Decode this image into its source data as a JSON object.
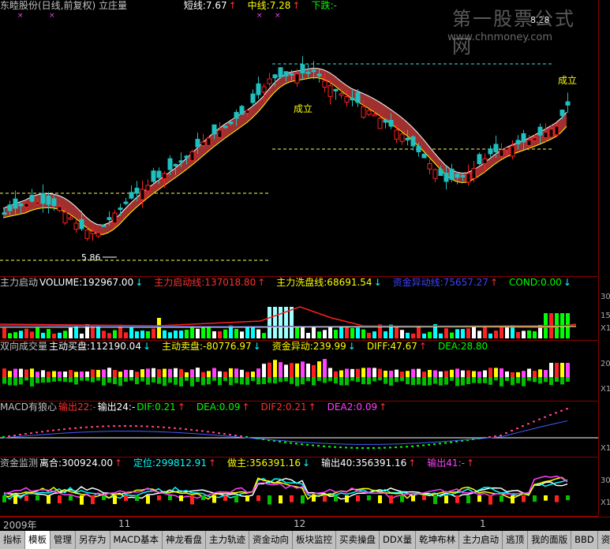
{
  "main": {
    "title": "东睦股份(日线,前复权) 立庄量",
    "legend": [
      {
        "text": "短线:7.67",
        "color": "#ffffff"
      },
      {
        "text": "↑",
        "color": "#ff3030"
      },
      {
        "text": "中线:7.28",
        "color": "#ffff00"
      },
      {
        "text": "↑",
        "color": "#ff3030"
      },
      {
        "text": "下跌:-",
        "color": "#00ff00"
      }
    ],
    "high_label": "8.28",
    "low_label": "5.86",
    "signal_1": "成立",
    "signal_2": "成立"
  },
  "watermark": {
    "line1": "第一股票公式网",
    "line2": "www.chnmoney.com"
  },
  "panel1": {
    "legend": [
      {
        "text": "主力启动",
        "color": "#c0c0c0"
      },
      {
        "text": "VOLUME:192967.00",
        "color": "#ffffff"
      },
      {
        "text": "↓",
        "color": "#00ffff"
      },
      {
        "text": "主力启动线:137018.80",
        "color": "#ff3030"
      },
      {
        "text": "↑",
        "color": "#ff3030"
      },
      {
        "text": "主力洗盘线:68691.54",
        "color": "#ffff00"
      },
      {
        "text": "↓",
        "color": "#00ffff"
      },
      {
        "text": "资金异动线:75657.27",
        "color": "#4040ff"
      },
      {
        "text": "↑",
        "color": "#ff3030"
      },
      {
        "text": "COND:0.00",
        "color": "#00ff00"
      },
      {
        "text": "↓",
        "color": "#00ffff"
      }
    ],
    "scale": [
      "30",
      "15",
      "X1"
    ]
  },
  "panel2": {
    "legend": [
      {
        "text": "双向成交量",
        "color": "#c0c0c0"
      },
      {
        "text": "主动买盘:112190.04",
        "color": "#ffffff"
      },
      {
        "text": "↓",
        "color": "#00ffff"
      },
      {
        "text": "主动卖盘:-80776.97",
        "color": "#ffff00"
      },
      {
        "text": "↓",
        "color": "#00ffff"
      },
      {
        "text": "资金异动:239.99",
        "color": "#ffff00"
      },
      {
        "text": "↓",
        "color": "#00ffff"
      },
      {
        "text": "DIFF:47.67",
        "color": "#ffff00"
      },
      {
        "text": "↑",
        "color": "#ff3030"
      },
      {
        "text": "DEA:28.80",
        "color": "#00ff00"
      }
    ],
    "scale": [
      "20",
      "X1"
    ]
  },
  "panel3": {
    "legend": [
      {
        "text": "MACD有狼心",
        "color": "#c0c0c0"
      },
      {
        "text": "输出22:-",
        "color": "#ff3030"
      },
      {
        "text": "输出24:-",
        "color": "#ffffff"
      },
      {
        "text": "DIF:0.21",
        "color": "#00ff00"
      },
      {
        "text": "↑",
        "color": "#ff3030"
      },
      {
        "text": "DEA:0.09",
        "color": "#00ff00"
      },
      {
        "text": "↑",
        "color": "#ff3030"
      },
      {
        "text": "DIF2:0.21",
        "color": "#ff3030"
      },
      {
        "text": "↑",
        "color": "#ff3030"
      },
      {
        "text": "DEA2:0.09",
        "color": "#ff40ff"
      },
      {
        "text": "↑",
        "color": "#ff3030"
      }
    ],
    "scale": [
      "X1"
    ]
  },
  "panel4": {
    "legend": [
      {
        "text": "资金监测",
        "color": "#c0c0c0"
      },
      {
        "text": "离合:300924.00",
        "color": "#ffffff"
      },
      {
        "text": "↑",
        "color": "#ff3030"
      },
      {
        "text": "定位:299812.91",
        "color": "#00ffff"
      },
      {
        "text": "↑",
        "color": "#ff3030"
      },
      {
        "text": "做主:356391.16",
        "color": "#ffff00"
      },
      {
        "text": "↓",
        "color": "#00ffff"
      },
      {
        "text": "输出40:356391.16",
        "color": "#ffffff"
      },
      {
        "text": "↑",
        "color": "#ff3030"
      },
      {
        "text": "输出41:-",
        "color": "#ff40ff"
      },
      {
        "text": "↑",
        "color": "#ff3030"
      }
    ],
    "scale": [
      "30",
      "X1"
    ]
  },
  "timeaxis": {
    "labels": [
      "2009年",
      "11",
      "12",
      "1"
    ]
  },
  "tabs": [
    "指标",
    "模板",
    "管理",
    "另存为",
    "MACD基本",
    "神龙看盘",
    "主力轨迹",
    "资金动向",
    "板块监控",
    "买卖操盘",
    "DDX量",
    "乾坤布林",
    "主力启动",
    "逃顶",
    "我的面版",
    "BBD",
    "资金监"
  ]
}
